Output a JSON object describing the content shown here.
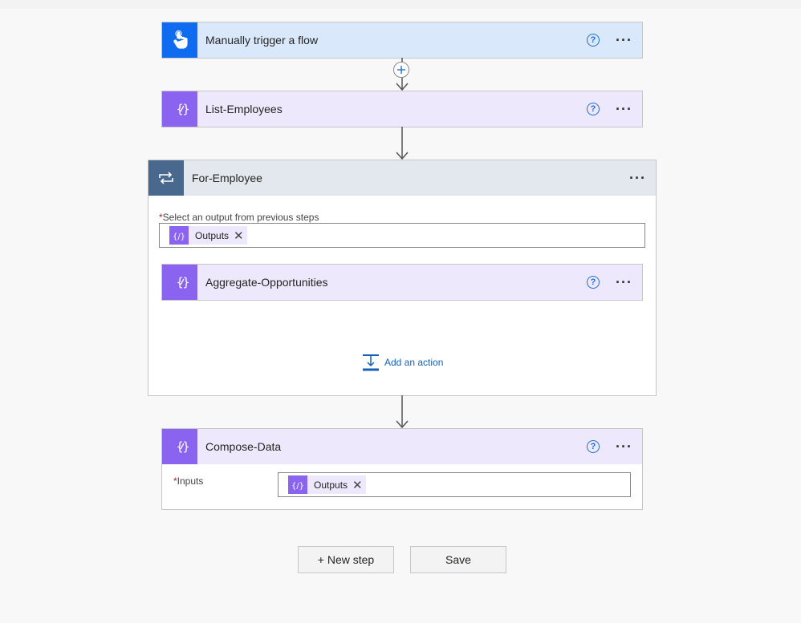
{
  "steps": {
    "trigger": {
      "title": "Manually trigger a flow",
      "help": "?",
      "more": "···"
    },
    "list": {
      "title": "List-Employees",
      "help": "?",
      "more": "···"
    },
    "loop": {
      "title": "For-Employee",
      "more": "···",
      "field_label": "Select an output from previous steps",
      "token_label": "Outputs",
      "inner": {
        "title": "Aggregate-Opportunities",
        "help": "?",
        "more": "···"
      },
      "add_action": "Add an action"
    },
    "compose": {
      "title": "Compose-Data",
      "help": "?",
      "more": "···",
      "field_label": "Inputs",
      "token_label": "Outputs"
    }
  },
  "buttons": {
    "new_step": "+ New step",
    "save": "Save"
  },
  "colors": {
    "trigger_bg": "#d9e8fa",
    "trigger_icon": "#0f6cf0",
    "variable_icon": "#8a64f1",
    "variable_bg": "#ede8fb",
    "loop_icon": "#48688e",
    "loop_head": "#e3e7ee",
    "link": "#1560b6"
  },
  "icons": {
    "trigger": "touch-hand-icon",
    "variable": "curly-braces-edit-icon",
    "loop": "repeat-loop-icon",
    "help": "help-circle-icon",
    "more": "ellipsis-icon",
    "remove": "close-icon",
    "add": "add-step-plus-icon",
    "add_action": "insert-action-icon"
  }
}
